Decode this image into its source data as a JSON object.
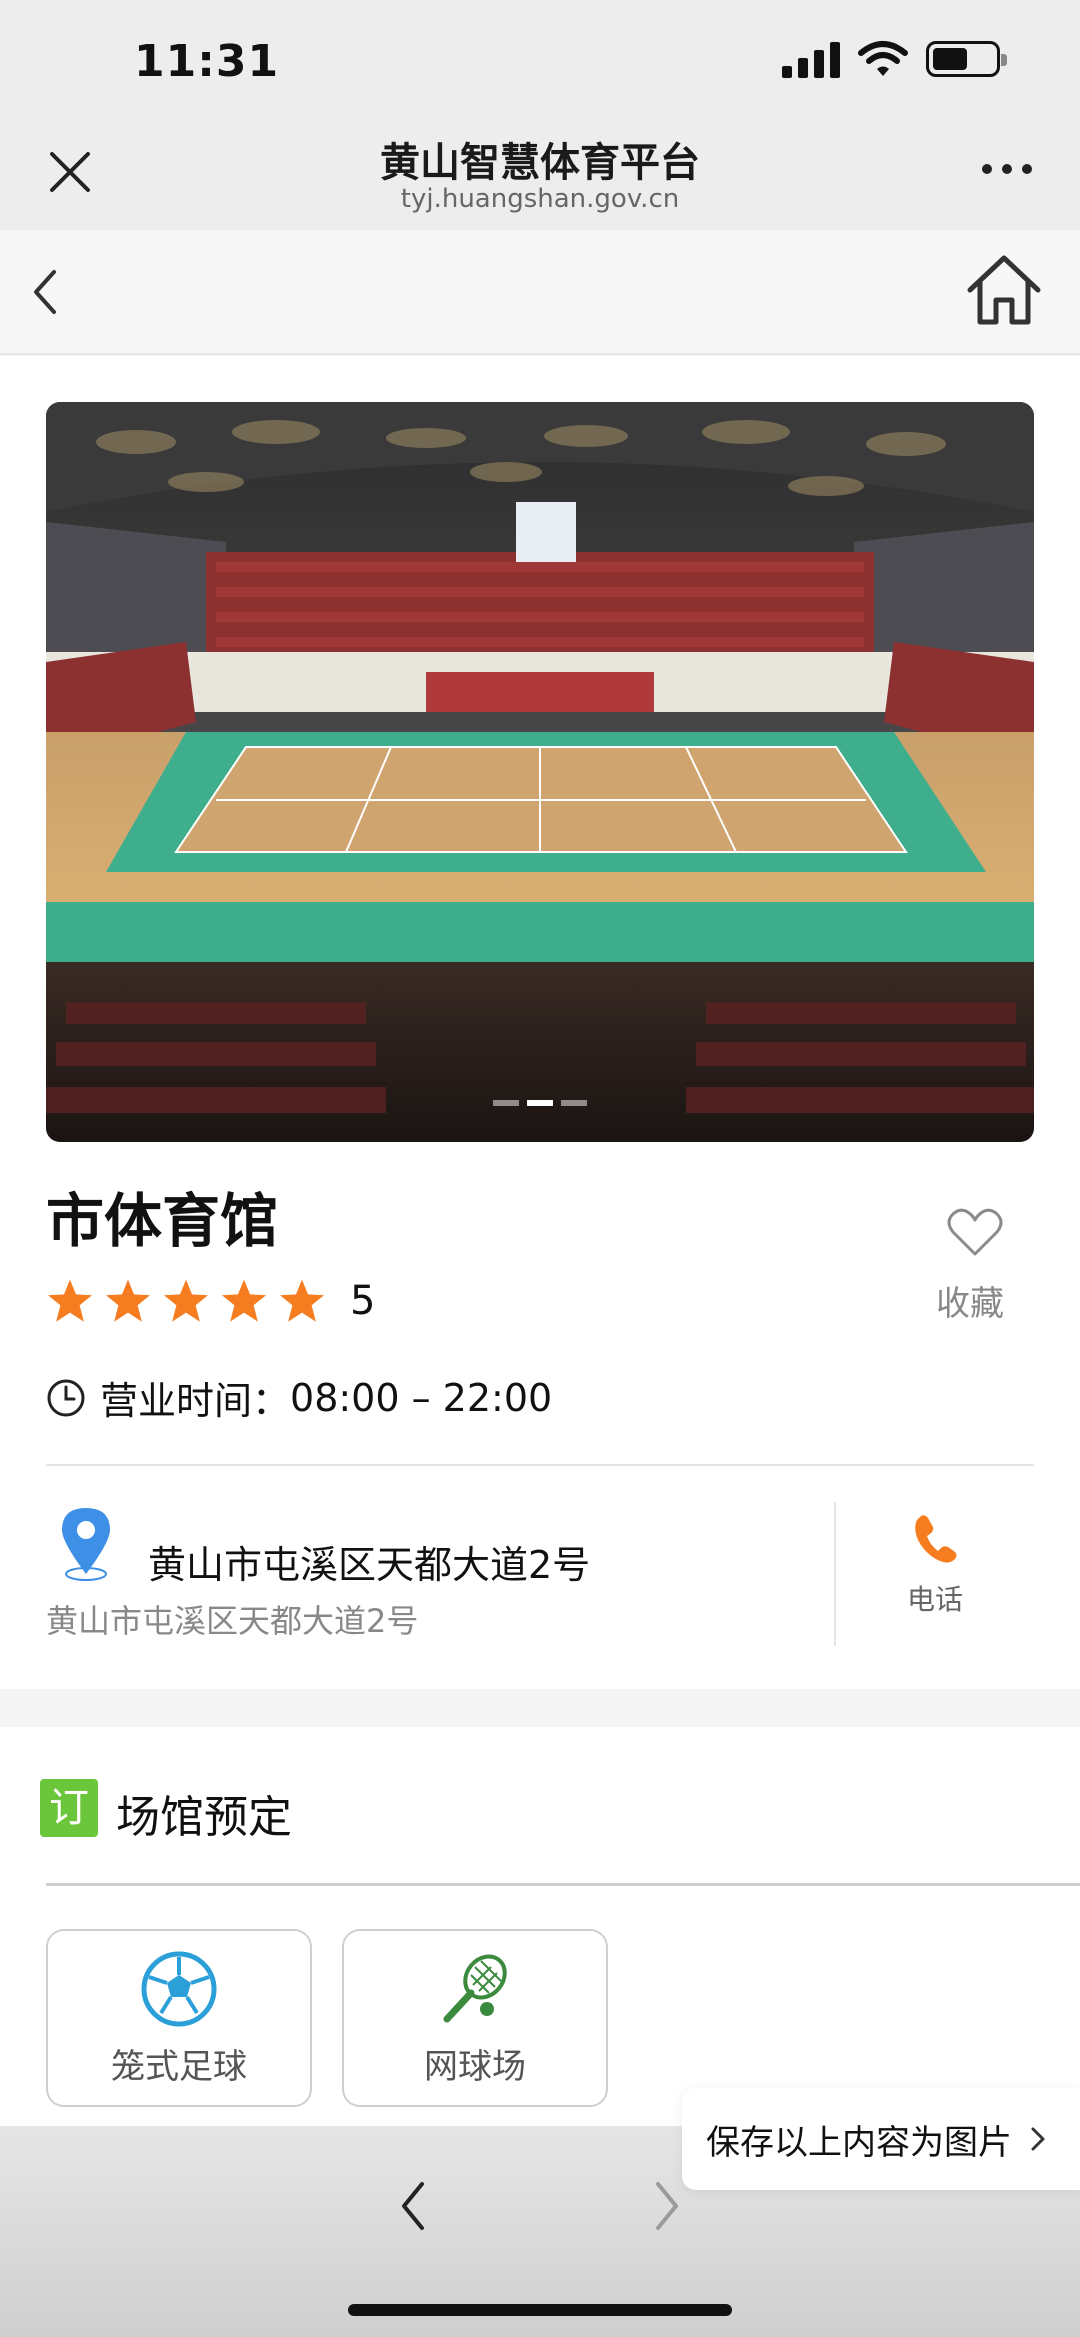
{
  "status_bar": {
    "time": "11:31"
  },
  "nav": {
    "title": "黄山智慧体育平台",
    "subtitle": "tyj.huangshan.gov.cn"
  },
  "venue": {
    "name": "市体育馆",
    "rating": 5,
    "rating_text": "5",
    "hours_label": "营业时间：",
    "hours": "08:00 – 22:00",
    "favorite_label": "收藏",
    "address_main": "黄山市屯溪区天都大道2号",
    "address_sub": "黄山市屯溪区天都大道2号",
    "phone_label": "电话",
    "carousel": {
      "total": 3,
      "active_index": 1
    }
  },
  "booking": {
    "badge": "订",
    "title": "场馆预定",
    "items": [
      {
        "label": "笼式足球",
        "icon": "soccer-ball-icon"
      },
      {
        "label": "网球场",
        "icon": "tennis-racket-icon"
      }
    ]
  },
  "save_image": {
    "label": "保存以上内容为图片"
  },
  "colors": {
    "star": "#f57c1f",
    "phone": "#f57c1f",
    "pin": "#3e8fe6",
    "soccer": "#2a9fd8",
    "tennis": "#3b8a3e",
    "badge": "#6cc63c"
  }
}
